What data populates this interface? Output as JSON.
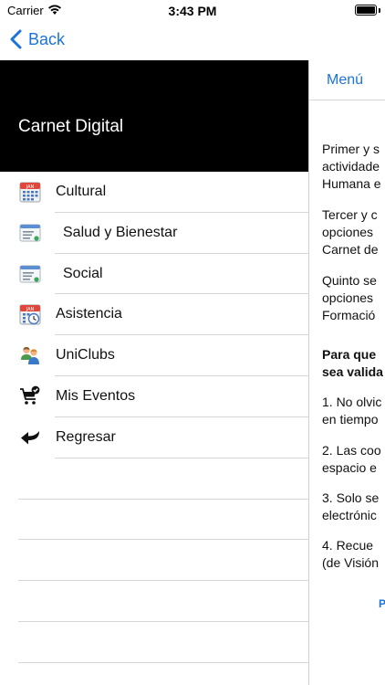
{
  "status_bar": {
    "carrier": "Carrier",
    "time": "3:43 PM"
  },
  "nav": {
    "back_label": "Back"
  },
  "drawer": {
    "title": "Carnet Digital",
    "items": [
      {
        "label": "Cultural",
        "icon": "calendar-icon"
      },
      {
        "label": "Salud y Bienestar",
        "icon": "list-icon"
      },
      {
        "label": "Social",
        "icon": "list-icon"
      },
      {
        "label": "Asistencia",
        "icon": "calendar-clock-icon"
      },
      {
        "label": "UniClubs",
        "icon": "people-icon"
      },
      {
        "label": "Mis Eventos",
        "icon": "cart-check-icon"
      },
      {
        "label": "Regresar",
        "icon": "return-arrow-icon"
      }
    ]
  },
  "content": {
    "menu_label": "Menú",
    "p1": [
      "Primer y s",
      "actividade",
      "Humana e"
    ],
    "p2": [
      "Tercer y c",
      "opciones",
      "Carnet de"
    ],
    "p3": [
      "Quinto se",
      "opciones",
      "Formació"
    ],
    "p4": [
      "Para que",
      "sea valida"
    ],
    "p5": [
      "1. No olvic",
      "en tiempo"
    ],
    "p6": [
      "2. Las coo",
      "espacio e"
    ],
    "p7": [
      "3.  Solo se",
      "electrónic"
    ],
    "p8": [
      "4.  Recue",
      "(de Visión"
    ],
    "link": "P"
  },
  "colors": {
    "accent": "#1a73d9",
    "header_bg": "#000000"
  }
}
